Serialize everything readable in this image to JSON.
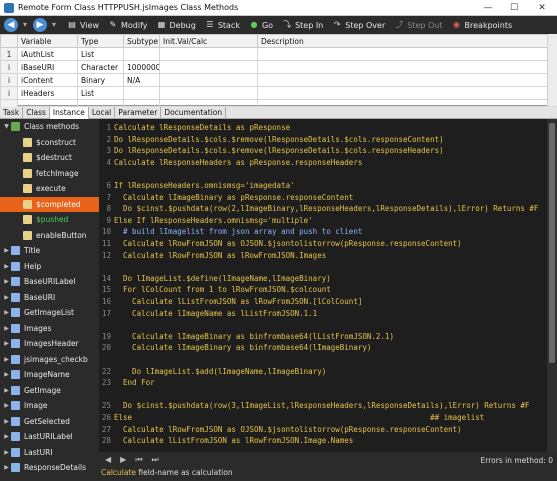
{
  "window": {
    "title": "Remote Form Class HTTPPUSH.jsImages Class Methods",
    "minimize": "—",
    "maximize": "☐",
    "close": "✕"
  },
  "toolbar": {
    "view": "View",
    "modify": "Modify",
    "debug": "Debug",
    "stack": "Stack",
    "go": "Go",
    "step_in": "Step In",
    "step_over": "Step Over",
    "step_out": "Step Out",
    "breakpoints": "Breakpoints"
  },
  "variables": {
    "headers": [
      "",
      "Variable",
      "Type",
      "Subtype",
      "Init.Val/Calc",
      "Description"
    ],
    "rows": [
      {
        "num": "1",
        "name": "iAuthList",
        "type": "List",
        "subtype": "",
        "init": "",
        "desc": ""
      },
      {
        "num": "i",
        "name": "iBaseURI",
        "type": "Character",
        "subtype": "100000000",
        "init": "",
        "desc": ""
      },
      {
        "num": "i",
        "name": "iContent",
        "type": "Binary",
        "subtype": "N/A",
        "init": "",
        "desc": ""
      },
      {
        "num": "i",
        "name": "iHeaders",
        "type": "List",
        "subtype": "",
        "init": "",
        "desc": ""
      }
    ]
  },
  "tabs": [
    "Task",
    "Class",
    "Instance",
    "Local",
    "Parameter",
    "Documentation"
  ],
  "methods": [
    {
      "label": "Class methods",
      "kind": "cls",
      "indent": 0,
      "state": ""
    },
    {
      "label": "$construct",
      "kind": "meth",
      "indent": 1,
      "state": ""
    },
    {
      "label": "$destruct",
      "kind": "meth",
      "indent": 1,
      "state": ""
    },
    {
      "label": "fetchImage",
      "kind": "meth",
      "indent": 1,
      "state": ""
    },
    {
      "label": "execute",
      "kind": "meth",
      "indent": 1,
      "state": ""
    },
    {
      "label": "$completed",
      "kind": "meth",
      "indent": 1,
      "state": "sel"
    },
    {
      "label": "$pushed",
      "kind": "meth",
      "indent": 1,
      "state": "green"
    },
    {
      "label": "enableButton",
      "kind": "meth",
      "indent": 1,
      "state": ""
    },
    {
      "label": "Title",
      "kind": "fld",
      "indent": 0,
      "state": ""
    },
    {
      "label": "Help",
      "kind": "fld",
      "indent": 0,
      "state": ""
    },
    {
      "label": "BaseURILabel",
      "kind": "fld",
      "indent": 0,
      "state": ""
    },
    {
      "label": "BaseURI",
      "kind": "fld",
      "indent": 0,
      "state": ""
    },
    {
      "label": "GetImageList",
      "kind": "fld",
      "indent": 0,
      "state": ""
    },
    {
      "label": "Images",
      "kind": "fld",
      "indent": 0,
      "state": ""
    },
    {
      "label": "ImagesHeader",
      "kind": "fld",
      "indent": 0,
      "state": ""
    },
    {
      "label": "jsimages_checkb",
      "kind": "fld",
      "indent": 0,
      "state": ""
    },
    {
      "label": "ImageName",
      "kind": "fld",
      "indent": 0,
      "state": ""
    },
    {
      "label": "GetImage",
      "kind": "fld",
      "indent": 0,
      "state": ""
    },
    {
      "label": "Image",
      "kind": "fld",
      "indent": 0,
      "state": ""
    },
    {
      "label": "GetSelected",
      "kind": "fld",
      "indent": 0,
      "state": ""
    },
    {
      "label": "LastURILabel",
      "kind": "fld",
      "indent": 0,
      "state": ""
    },
    {
      "label": "LastURI",
      "kind": "fld",
      "indent": 0,
      "state": ""
    },
    {
      "label": "ResponseDetails",
      "kind": "fld",
      "indent": 0,
      "state": ""
    }
  ],
  "code": [
    {
      "n": "1",
      "t": "Calculate lResponseDetails as pResponse"
    },
    {
      "n": "2",
      "t": "Do lResponseDetails.$cols.$remove(lResponseDetails.$cols.responseContent)"
    },
    {
      "n": "3",
      "t": "Do lResponseDetails.$cols.$remove(lResponseDetails.$cols.responseHeaders)"
    },
    {
      "n": "4",
      "t": "Calculate lResponseHeaders as pResponse.responseHeaders"
    },
    {
      "n": "",
      "t": ""
    },
    {
      "n": "6",
      "t": "If lResponseHeaders.omnismsg='imagedata'"
    },
    {
      "n": "7",
      "t": "  Calculate lImageBinary as pResponse.responseContent"
    },
    {
      "n": "8",
      "t": "  Do $cinst.$pushdata(row(2,lImageBinary,lResponseHeaders,lResponseDetails),lError) Returns #F"
    },
    {
      "n": "9",
      "t": "Else If lResponseHeaders.omnismsg='multiple'"
    },
    {
      "n": "10",
      "t": "  # build lImagelist from json array and push to client"
    },
    {
      "n": "11",
      "t": "  Calculate lRowFromJSON as OJSON.$jsontolistorrow(pResponse.responseContent)"
    },
    {
      "n": "12",
      "t": "  Calculate lRowFromJSON as lRowFromJSON.Images"
    },
    {
      "n": "",
      "t": ""
    },
    {
      "n": "14",
      "t": "  Do lImageList.$define(lImageName,lImageBinary)"
    },
    {
      "n": "15",
      "t": "  For lColCount from 1 to lRowFromJSON.$colcount"
    },
    {
      "n": "16",
      "t": "    Calculate lListFromJSON as lRowFromJSON.[lColCount]"
    },
    {
      "n": "17",
      "t": "    Calculate lImageName as lListFromJSON.1.1"
    },
    {
      "n": "",
      "t": ""
    },
    {
      "n": "19",
      "t": "    Calculate lImageBinary as binfrombase64(lListFromJSON.2.1)"
    },
    {
      "n": "20",
      "t": "    Calculate lImageBinary as binfrombase64(lImageBinary)"
    },
    {
      "n": "",
      "t": ""
    },
    {
      "n": "22",
      "t": "    Do lImageList.$add(lImageName,lImageBinary)"
    },
    {
      "n": "23",
      "t": "  End For"
    },
    {
      "n": "",
      "t": ""
    },
    {
      "n": "25",
      "t": "  Do $cinst.$pushdata(row(3,lImageList,lResponseHeaders,lResponseDetails),lError) Returns #F"
    },
    {
      "n": "26",
      "t": "Else                                                                  ## imagelist"
    },
    {
      "n": "27",
      "t": "  Calculate lRowFromJSON as OJSON.$jsontolistorrow(pResponse.responseContent)"
    },
    {
      "n": "28",
      "t": "  Calculate lListFromJSON as lRowFromJSON.Image.Names"
    }
  ],
  "status": {
    "errors": "Errors in method: 0",
    "hint_cmd": "Calculate",
    "hint_rest": " field-name as calculation"
  }
}
